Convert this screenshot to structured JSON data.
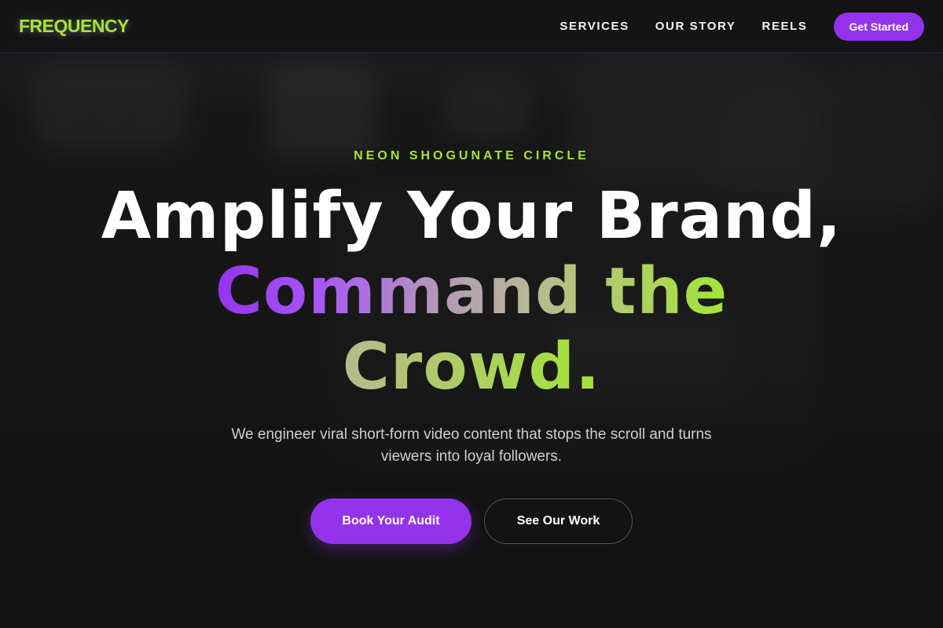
{
  "nav": {
    "logo": "FREQUENCY",
    "links": [
      "SERVICES",
      "OUR STORY",
      "REELS"
    ],
    "cta_label": "Get Started"
  },
  "hero": {
    "eyebrow": "NEON SHOGUNATE CIRCLE",
    "headline_line1": "Amplify Your Brand,",
    "headline_line2": "Command the",
    "headline_line3": "Crowd.",
    "subtitle": "We engineer viral short-form video content that stops the scroll and turns viewers into loyal followers.",
    "primary_button": "Book Your Audit",
    "secondary_button": "See Our Work"
  },
  "colors": {
    "accent_green": "#a3e635",
    "accent_purple": "#9333ea",
    "background": "#161616"
  }
}
